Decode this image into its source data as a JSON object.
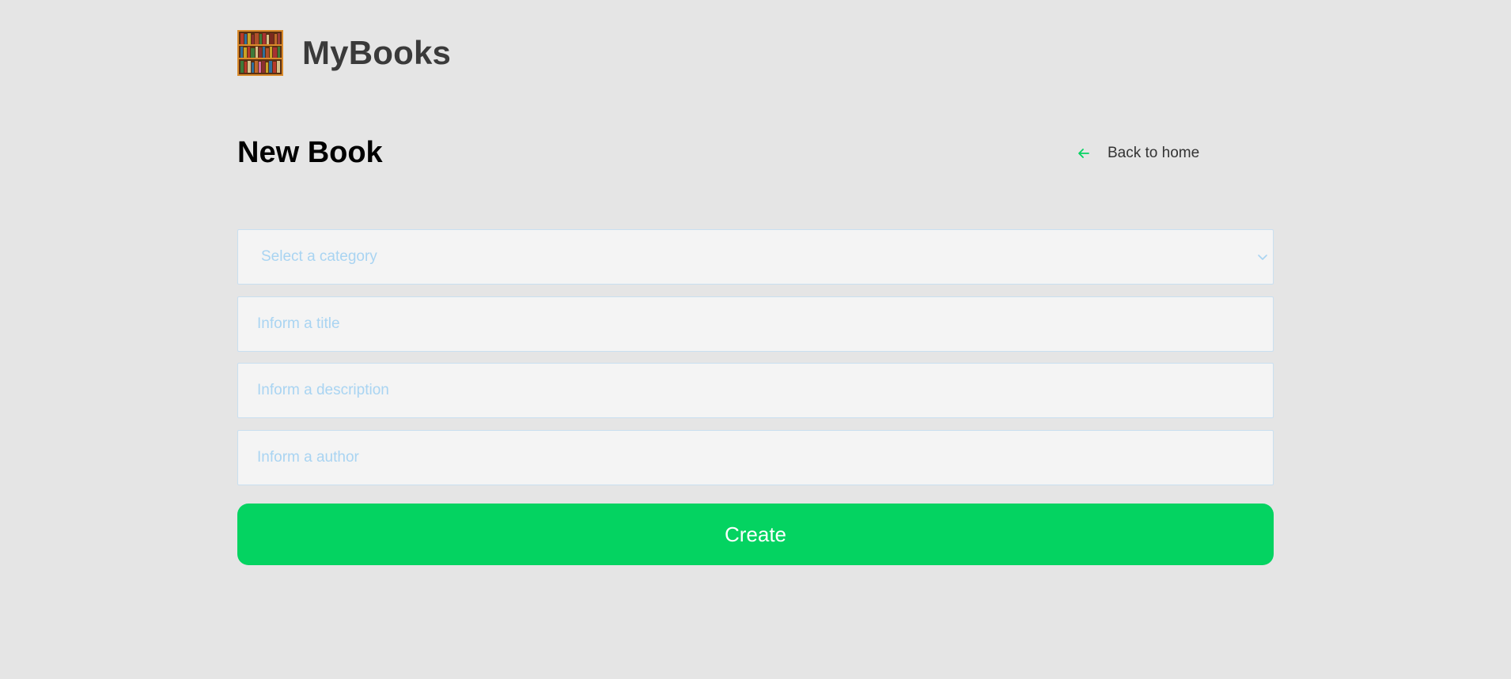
{
  "brand": {
    "name": "MyBooks",
    "logo_icon": "bookshelf-icon"
  },
  "page": {
    "title": "New Book"
  },
  "nav": {
    "back_label": "Back to home",
    "back_icon": "arrow-left-icon"
  },
  "form": {
    "category": {
      "placeholder": "Select a category",
      "value": "",
      "icon": "chevron-down-icon"
    },
    "title": {
      "placeholder": "Inform a title",
      "value": ""
    },
    "description": {
      "placeholder": "Inform a description",
      "value": ""
    },
    "author": {
      "placeholder": "Inform a author",
      "value": ""
    },
    "submit_label": "Create"
  },
  "colors": {
    "background": "#e5e5e5",
    "accent": "#04d361",
    "field_background": "#f4f4f4",
    "field_border": "#c9dff0",
    "placeholder": "#a9d4f2",
    "brand_text": "#3a3a3a"
  }
}
